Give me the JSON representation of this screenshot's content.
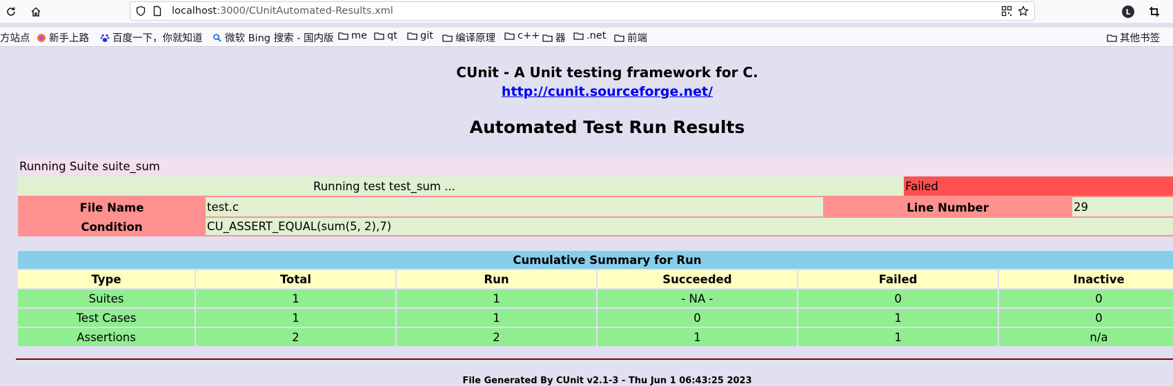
{
  "browser": {
    "url_host": "localhost",
    "url_path": ":3000/CUnitAutomated-Results.xml",
    "profile_initial": "L",
    "bookmarks": [
      {
        "label": "方站点",
        "icon": "none"
      },
      {
        "label": "新手上路",
        "icon": "firefox-icon"
      },
      {
        "label": "百度一下，你就知道",
        "icon": "baidu-icon"
      },
      {
        "label": "微软 Bing 搜索 - 国内版",
        "icon": "bing-search-icon"
      },
      {
        "label": "me",
        "icon": "folder-icon"
      },
      {
        "label": "qt",
        "icon": "folder-icon"
      },
      {
        "label": "git",
        "icon": "folder-icon"
      },
      {
        "label": "编译原理",
        "icon": "folder-icon"
      },
      {
        "label": "c++",
        "icon": "folder-icon"
      },
      {
        "label": "器",
        "icon": "folder-icon"
      },
      {
        "label": ".net",
        "icon": "folder-icon"
      },
      {
        "label": "前端",
        "icon": "folder-icon"
      }
    ],
    "other_bookmarks": "其他书签"
  },
  "header": {
    "title": "CUnit - A Unit testing framework for C.",
    "link": "http://cunit.sourceforge.net/",
    "main_title": "Automated Test Run Results"
  },
  "suite": {
    "label": "Running Suite suite_sum",
    "test_label": "Running test test_sum ...",
    "status": "Failed",
    "file_label": "File Name",
    "file_value": "test.c",
    "line_label": "Line Number",
    "line_value": "29",
    "condition_label": "Condition",
    "condition_value": "CU_ASSERT_EQUAL(sum(5, 2),7)"
  },
  "summary": {
    "title": "Cumulative Summary for Run",
    "columns": [
      "Type",
      "Total",
      "Run",
      "Succeeded",
      "Failed",
      "Inactive"
    ],
    "rows": [
      [
        "Suites",
        "1",
        "1",
        "- NA -",
        "0",
        "0"
      ],
      [
        "Test Cases",
        "1",
        "1",
        "0",
        "1",
        "0"
      ],
      [
        "Assertions",
        "2",
        "2",
        "1",
        "1",
        "n/a"
      ]
    ]
  },
  "footer": "File Generated By CUnit v2.1-3 - Thu Jun 1 06:43:25 2023",
  "colors": {
    "page_bg": "#e0e0f0",
    "failed": "#ff5050",
    "label_bg": "#ff9090",
    "summary_head": "#87ceeb",
    "column_head": "#ffffc0",
    "data_bg": "#90ee90"
  }
}
